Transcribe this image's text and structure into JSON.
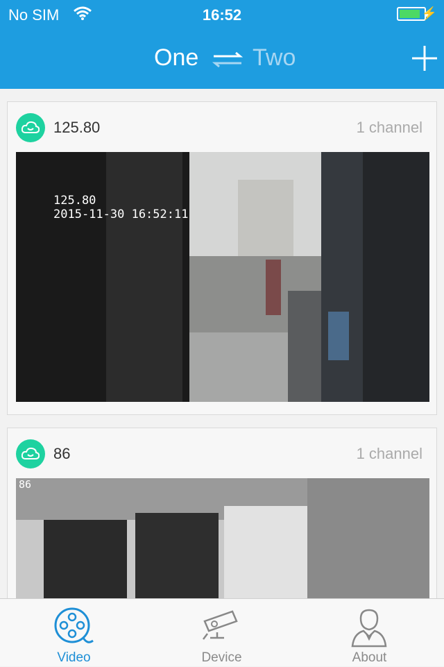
{
  "status_bar": {
    "carrier": "No SIM",
    "time": "16:52",
    "battery_level": 0.85
  },
  "nav": {
    "segment_one": "One",
    "segment_two": "Two"
  },
  "devices": [
    {
      "name": "125.80",
      "channel": "1 channel",
      "osd": "125.80\n2015-11-30 16:52:11"
    },
    {
      "name": "86",
      "channel": "1 channel",
      "osd": "86"
    }
  ],
  "tabs": [
    {
      "label": "Video",
      "icon": "film-reel-icon"
    },
    {
      "label": "Device",
      "icon": "camera-icon"
    },
    {
      "label": "About",
      "icon": "person-icon"
    }
  ],
  "colors": {
    "accent": "#1e9de0",
    "active_tab": "#1e8fd6",
    "cloud": "#1ed2a0"
  }
}
